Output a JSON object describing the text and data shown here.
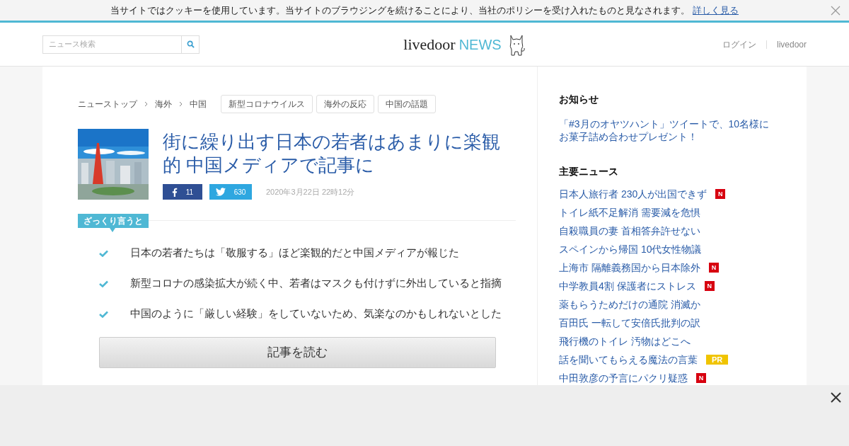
{
  "cookie_bar": {
    "message": "当サイトではクッキーを使用しています。当サイトのブラウジングを続けることにより、当社のポリシーを受け入れたものと見なされます。",
    "link": "詳しく見る"
  },
  "header": {
    "search": {
      "placeholder": "ニュース検索"
    },
    "logo": {
      "brand": "livedoor",
      "product": "NEWS"
    },
    "links": [
      "ログイン",
      "livedoor"
    ]
  },
  "breadcrumb": [
    "ニューストップ",
    "海外",
    "中国"
  ],
  "tags": [
    "新型コロナウイルス",
    "海外の反応",
    "中国の話題"
  ],
  "article": {
    "kind": "picture",
    "title": "街に繰り出す日本の若者はあまりに楽観的 中国メディアで記事に",
    "shares": [
      {
        "kind": "facebook",
        "count": "11"
      },
      {
        "kind": "twitter",
        "count": "630"
      }
    ],
    "date": "2020年3月22日 22時12分"
  },
  "summary": {
    "label": "ざっくり言うと",
    "points": [
      "日本の若者たちは「敬服する」ほど楽観的だと中国メディアが報じた",
      "新型コロナの感染拡大が続く中、若者はマスクも付けずに外出していると指摘",
      "中国のように「厳しい経験」をしていないため、気楽なのかもしれないとした"
    ],
    "button": "記事を読む"
  },
  "sidebar": {
    "notice": {
      "heading": "お知らせ",
      "text": "「#3月のオヤツハント」ツイートで、10名様にお菓子詰め合わせプレゼント！"
    },
    "news": {
      "heading": "主要ニュース",
      "items": [
        {
          "title": "日本人旅行者 230人が出国できず",
          "badge": {
            "kind": "new",
            "text": "N"
          }
        },
        {
          "title": "トイレ紙不足解消 需要減を危惧"
        },
        {
          "title": "自殺職員の妻 首相答弁許せない"
        },
        {
          "title": "スペインから帰国 10代女性物議"
        },
        {
          "title": "上海市 隔離義務国から日本除外",
          "badge": {
            "kind": "new",
            "text": "N"
          }
        },
        {
          "title": "中学教員4割 保護者にストレス",
          "badge": {
            "kind": "new",
            "text": "N"
          }
        },
        {
          "title": "薬もらうためだけの通院 消滅か"
        },
        {
          "title": "百田氏 一転して安倍氏批判の訳"
        },
        {
          "title": "飛行機のトイレ 汚物はどこへ"
        },
        {
          "title": "話を聞いてもらえる魔法の言葉",
          "badge": {
            "kind": "pr",
            "text": "PR"
          }
        },
        {
          "title": "中田敦彦の予言にパクリ疑惑",
          "badge": {
            "kind": "new",
            "text": "N"
          }
        }
      ]
    }
  },
  "ad_overlay": {
    "closable": true
  }
}
